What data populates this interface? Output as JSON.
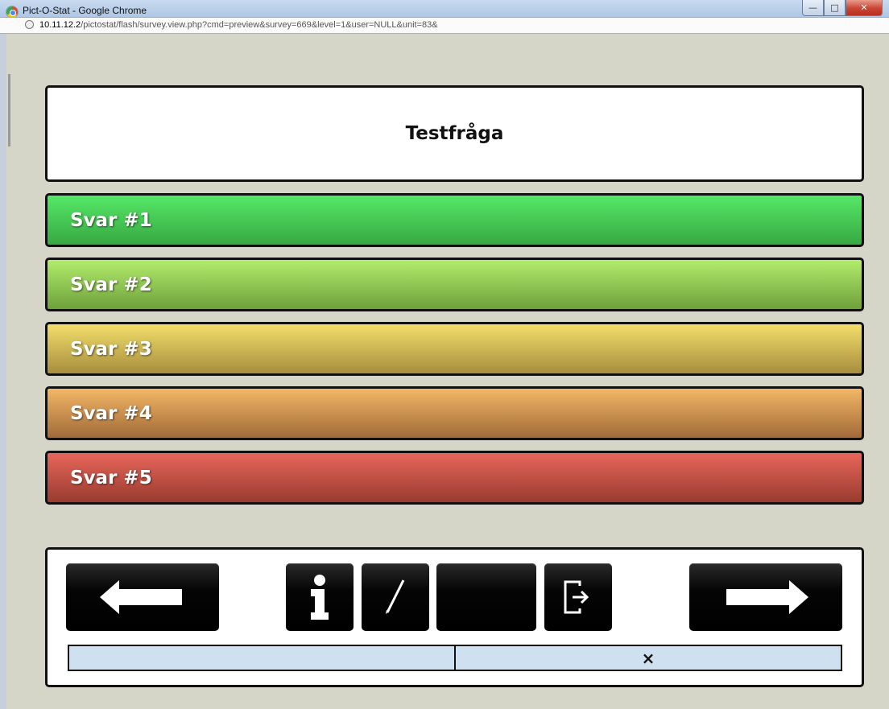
{
  "window": {
    "title": "Pict-O-Stat - Google Chrome",
    "url_host": "10.11.12.2",
    "url_path": "/pictostat/flash/survey.view.php?cmd=preview&survey=669&level=1&user=NULL&unit=83&",
    "icon": "chrome-icon"
  },
  "survey": {
    "question": "Testfråga",
    "answers": [
      {
        "label": "Svar #1",
        "color": "#4cd35e"
      },
      {
        "label": "Svar #2",
        "color": "#9fd85e"
      },
      {
        "label": "Svar #3",
        "color": "#e6cd5c"
      },
      {
        "label": "Svar #4",
        "color": "#e3a45c"
      },
      {
        "label": "Svar #5",
        "color": "#d9584c"
      }
    ]
  },
  "toolbar": {
    "buttons": [
      {
        "name": "previous",
        "icon": "arrow-left-icon"
      },
      {
        "name": "info",
        "icon": "info-icon"
      },
      {
        "name": "edit",
        "icon": "pen-icon"
      },
      {
        "name": "blank",
        "icon": ""
      },
      {
        "name": "exit",
        "icon": "exit-icon"
      },
      {
        "name": "next",
        "icon": "arrow-right-icon"
      }
    ],
    "progress_close_symbol": "×",
    "progress_fraction": 0.5
  }
}
